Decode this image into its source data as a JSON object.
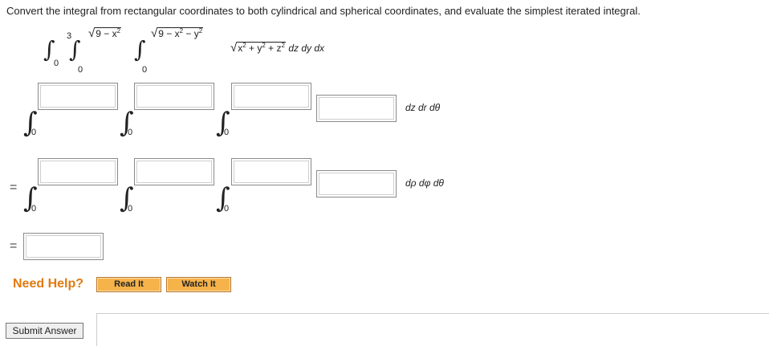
{
  "prompt": "Convert the integral from rectangular coordinates to both cylindrical and spherical coordinates, and evaluate the simplest iterated integral.",
  "given_integral": {
    "outer_upper": "3",
    "outer_lower": "0",
    "middle_upper_sqrt": "9 − x",
    "middle_upper_exp": "2",
    "middle_lower": "0",
    "inner_upper_sqrt": "9 − x",
    "inner_upper_exp1": "2",
    "inner_upper_mid": " − y",
    "inner_upper_exp2": "2",
    "inner_lower": "0",
    "integrand_x": "x",
    "integrand_exp1": "2",
    "integrand_y": " + y",
    "integrand_exp2": "2",
    "integrand_z": " + z",
    "integrand_exp3": "2",
    "differential": "dz dy dx"
  },
  "cylindrical": {
    "lower_limits": [
      "0",
      "0",
      "0"
    ],
    "differential": "dz dr dθ"
  },
  "spherical": {
    "lower_limits": [
      "0",
      "0",
      "0"
    ],
    "differential": "dρ dφ dθ"
  },
  "equals": "=",
  "help": {
    "label": "Need Help?",
    "read_it": "Read It",
    "watch_it": "Watch It"
  },
  "submit": "Submit Answer"
}
